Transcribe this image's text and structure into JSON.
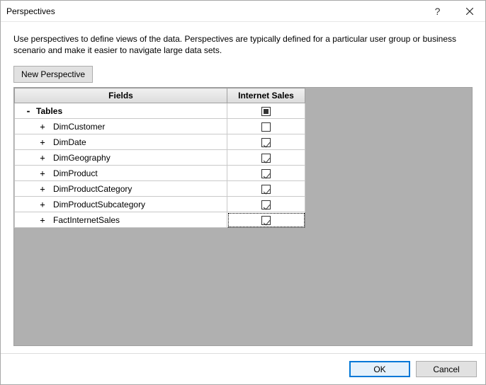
{
  "window": {
    "title": "Perspectives",
    "help_icon": "?"
  },
  "description": "Use perspectives to define views of the data. Perspectives are typically defined for a particular user group or business scenario and make it easier to navigate large data sets.",
  "toolbar": {
    "new_perspective_label": "New Perspective"
  },
  "columns": {
    "fields": "Fields",
    "perspective": "Internet Sales"
  },
  "tree": {
    "root": {
      "name": "Tables",
      "state": "indeterminate"
    },
    "children": [
      {
        "name": "DimCustomer",
        "checked": false
      },
      {
        "name": "DimDate",
        "checked": true
      },
      {
        "name": "DimGeography",
        "checked": true
      },
      {
        "name": "DimProduct",
        "checked": true
      },
      {
        "name": "DimProductCategory",
        "checked": true
      },
      {
        "name": "DimProductSubcategory",
        "checked": true
      },
      {
        "name": "FactInternetSales",
        "checked": true,
        "focused": true
      }
    ]
  },
  "buttons": {
    "ok": "OK",
    "cancel": "Cancel"
  }
}
